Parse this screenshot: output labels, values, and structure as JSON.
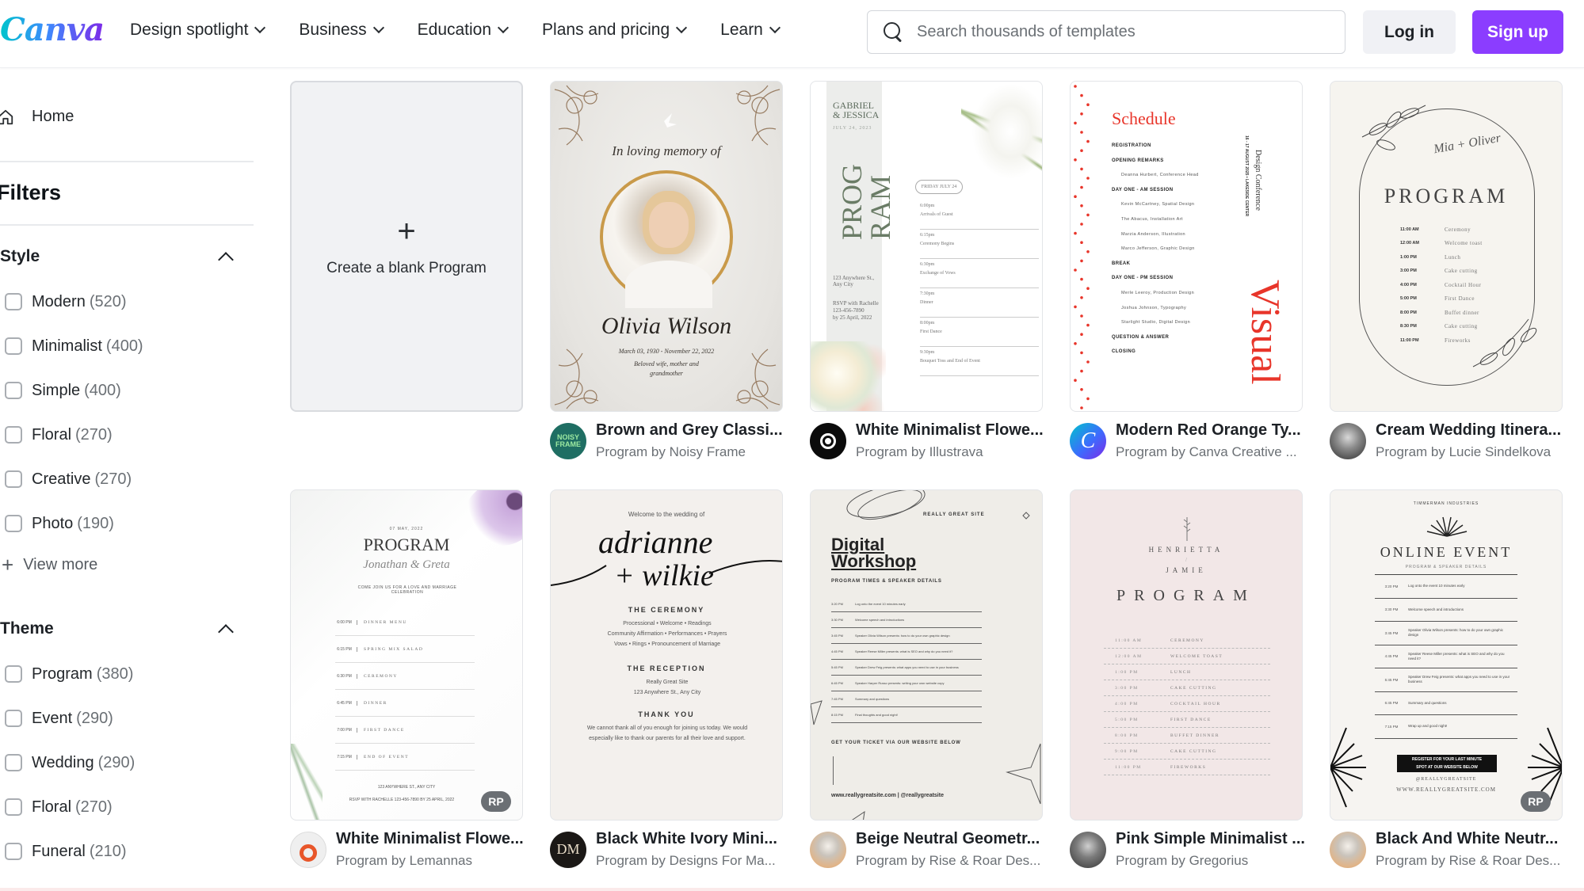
{
  "header": {
    "logo": "Canva",
    "nav": [
      {
        "label": "Design spotlight",
        "icon": "chevron-down-icon"
      },
      {
        "label": "Business",
        "icon": "chevron-down-icon"
      },
      {
        "label": "Education",
        "icon": "chevron-down-icon"
      },
      {
        "label": "Plans and pricing",
        "icon": "chevron-down-icon"
      },
      {
        "label": "Learn",
        "icon": "chevron-down-icon"
      }
    ],
    "search": {
      "placeholder": "Search thousands of templates",
      "value": "",
      "icon": "search-icon"
    },
    "login_label": "Log in",
    "signup_label": "Sign up",
    "colors": {
      "brand_purple": "#8b3dff",
      "login_bg": "#f0f1f5"
    }
  },
  "sidebar": {
    "home_label": "Home",
    "filters_title": "Filters",
    "style": {
      "title": "Style",
      "expanded": true,
      "items": [
        {
          "label": "Modern",
          "count": "(520)",
          "checked": false
        },
        {
          "label": "Minimalist",
          "count": "(400)",
          "checked": false
        },
        {
          "label": "Simple",
          "count": "(400)",
          "checked": false
        },
        {
          "label": "Floral",
          "count": "(270)",
          "checked": false
        },
        {
          "label": "Creative",
          "count": "(270)",
          "checked": false
        },
        {
          "label": "Photo",
          "count": "(190)",
          "checked": false
        }
      ],
      "view_more": "View more"
    },
    "theme": {
      "title": "Theme",
      "expanded": true,
      "items": [
        {
          "label": "Program",
          "count": "(380)",
          "checked": false
        },
        {
          "label": "Event",
          "count": "(290)",
          "checked": false
        },
        {
          "label": "Wedding",
          "count": "(290)",
          "checked": false
        },
        {
          "label": "Floral",
          "count": "(270)",
          "checked": false
        },
        {
          "label": "Funeral",
          "count": "(210)",
          "checked": false
        }
      ]
    }
  },
  "grid": {
    "blank_card": {
      "label": "Create a blank Program"
    },
    "templates": [
      {
        "title": "Brown and Grey Classi...",
        "subtitle": "Program by Noisy Frame",
        "thumb": {
          "line1": "In loving memory of",
          "name": "Olivia Wilson",
          "dates": "March 03, 1930 - November 22, 2022",
          "note1": "Beloved wife, mother and",
          "note2": "grandmother"
        }
      },
      {
        "title": "White Minimalist Flowe...",
        "subtitle": "Program by Illustrava",
        "thumb": {
          "names1": "GABRIEL",
          "names2": "& JESSICA",
          "date": "JULY 24, 2023",
          "word1": "PROG",
          "word2": "RAM",
          "pill": "FRIDAY JULY 24",
          "address": "123 Anywhere St., Any City",
          "rsvp1": "RSVP with Rachelle",
          "rsvp2": "123-456-7890",
          "rsvp3": "by 25 April, 2022",
          "rows": [
            [
              "6:00pm",
              "Arrivals of Guest"
            ],
            [
              "6:15pm",
              "Ceremony Begins"
            ],
            [
              "6:30pm",
              "Exchange of Vows"
            ],
            [
              "7:30pm",
              "Dinner"
            ],
            [
              "8:00pm",
              "First Dance"
            ],
            [
              "9:30pm",
              "Bouquet Toss and End of Event"
            ]
          ]
        }
      },
      {
        "title": "Modern Red Orange Ty...",
        "subtitle": "Program by Canva Creative ...",
        "thumb": {
          "heading": "Schedule",
          "side1": "Design Conference",
          "side2": "16 - 17 AUGUST 2025  •  LAKESIDE CENTER",
          "big": "Visual",
          "rows": [
            [
              "h",
              "REGISTRATION"
            ],
            [
              "h",
              "OPENING REMARKS"
            ],
            [
              "s",
              "Deanna Hurbert, Conference Head"
            ],
            [
              "h",
              "DAY ONE - AM SESSION"
            ],
            [
              "s",
              "Kevin McCartney, Spatial Design"
            ],
            [
              "s",
              "The Abacus, Installation Art"
            ],
            [
              "s",
              "Marzia Anderson, Illustration"
            ],
            [
              "s",
              "Marco Jefferson, Graphic Design"
            ],
            [
              "h",
              "BREAK"
            ],
            [
              "h",
              "DAY ONE - PM SESSION"
            ],
            [
              "s",
              "Merle Leeroy, Production Design"
            ],
            [
              "s",
              "Joshua Johnson, Typography"
            ],
            [
              "s",
              "Starlight Studio, Digital Design"
            ],
            [
              "h",
              "QUESTION & ANSWER"
            ],
            [
              "h",
              "CLOSING"
            ]
          ]
        }
      },
      {
        "title": "Cream Wedding Itinera...",
        "subtitle": "Program by Lucie Sindelkova",
        "thumb": {
          "script": "Mia + Oliver",
          "heading": "PROGRAM",
          "rows": [
            [
              "11:00 AM",
              "Ceremony"
            ],
            [
              "12:00 AM",
              "Welcome toast"
            ],
            [
              "1:00 PM",
              "Lunch"
            ],
            [
              "3:00 PM",
              "Cake cutting"
            ],
            [
              "4:00 PM",
              "Cocktail Hour"
            ],
            [
              "5:00 PM",
              "First Dance"
            ],
            [
              "8:00 PM",
              "Buffet dinner"
            ],
            [
              "8:30 PM",
              "Cake cutting"
            ],
            [
              "11:00 PM",
              "Fireworks"
            ]
          ]
        }
      },
      {
        "title": "White Minimalist Flowe...",
        "subtitle": "Program by Lemannas",
        "badge": "RP",
        "thumb": {
          "date": "07 MAY, 2022",
          "heading": "PROGRAM",
          "script": "Jonathan & Greta",
          "tagline": "COME JOIN US FOR A LOVE AND MARRIAGE CELEBRATION",
          "rows": [
            [
              "6:00 PM",
              "DINNER MENU"
            ],
            [
              "6:15 PM",
              "SPRING MIX SALAD"
            ],
            [
              "6:30 PM",
              "CEREMONY"
            ],
            [
              "6:45 PM",
              "DINNER"
            ],
            [
              "7:00 PM",
              "FIRST DANCE"
            ],
            [
              "7:15 PM",
              "END OF EVENT"
            ]
          ],
          "footer1": "123 ANYWHERE ST., ANY CITY",
          "footer2": "RSVP WITH RACHELLE 123-456-7890 BY 25 APRIL, 2022"
        }
      },
      {
        "title": "Black White Ivory Mini...",
        "subtitle": "Program by Designs For Ma...",
        "thumb": {
          "welcome": "Welcome to the wedding of",
          "name1": "adrianne",
          "name2": "+ wilkie",
          "h1": "THE CEREMONY",
          "p1": "Processional • Welcome • Readings\nCommunity Affirmation • Performances • Prayers\nVows • Rings • Pronouncement of Marriage",
          "h2": "THE RECEPTION",
          "p2": "Really Great Site\n123 Anywhere St., Any City",
          "h3": "THANK YOU",
          "p3": "We cannot thank all of you enough for joining us today. We would especially like to thank our parents for all their love and support."
        }
      },
      {
        "title": "Beige Neutral Geometr...",
        "subtitle": "Program by Rise & Roar Des...",
        "thumb": {
          "site": "REALLY GREAT SITE",
          "heading1": "Digital",
          "heading2": "Workshop",
          "sub": "PROGRAM TIMES & SPEAKER DETAILS",
          "rows": [
            [
              "3:20 PM",
              "Log onto the event 10 minutes early"
            ],
            [
              "3:30 PM",
              "Welcome speech and introductions"
            ],
            [
              "3:45 PM",
              "Speaker Olivia Wilson presents: how to do your own graphic design"
            ],
            [
              "4:45 PM",
              "Speaker Reese Miller presents: what is SEO and why do you need it?"
            ],
            [
              "5:45 PM",
              "Speaker Drew Feig presents: what apps you need to use in your business"
            ],
            [
              "6:45 PM",
              "Speaker Harper Russo presents: writing your own website copy"
            ],
            [
              "7:45 PM",
              "Summary and questions"
            ],
            [
              "8:15 PM",
              "Final thoughts and good night!"
            ]
          ],
          "cta": "GET YOUR TICKET VIA OUR WEBSITE BELOW",
          "footer": "www.reallygreatsite.com | @reallygreatsite"
        }
      },
      {
        "title": "Pink Simple Minimalist ...",
        "subtitle": "Program by Gregorius",
        "thumb": {
          "name1": "HENRIETTA",
          "slash": "/",
          "name2": "JAMIE",
          "heading": "PROGRAM",
          "rows": [
            [
              "11:00 AM",
              "CEREMONY"
            ],
            [
              "12:00 AM",
              "WELCOME TOAST"
            ],
            [
              "1:00 PM",
              "LUNCH"
            ],
            [
              "3:00 PM",
              "CAKE CUTTING"
            ],
            [
              "4:00 PM",
              "COCKTAIL HOUR"
            ],
            [
              "5:00 PM",
              "FIRST DANCE"
            ],
            [
              "8:00 PM",
              "BUFFET DINNER"
            ],
            [
              "9:00 PM",
              "CAKE CUTTING"
            ],
            [
              "11:00 PM",
              "FIREWORKS"
            ]
          ]
        }
      },
      {
        "title": "Black And White Neutr...",
        "subtitle": "Program by Rise & Roar Des...",
        "badge": "RP",
        "thumb": {
          "arc": "TIMMERMAN INDUSTRIES",
          "heading": "ONLINE EVENT",
          "sub": "PROGRAM & SPEAKER DETAILS",
          "rows": [
            [
              "3:20 PM",
              "Log onto the event 10 minutes early"
            ],
            [
              "3:30 PM",
              "Welcome speech and introductions"
            ],
            [
              "3:45 PM",
              "Speaker Olivia Wilson presents: how to do your own graphic design"
            ],
            [
              "4:45 PM",
              "Speaker Reese Miller presents: what is SEO and why do you need it?"
            ],
            [
              "5:45 PM",
              "Speaker Drew Feig presents: what apps you need to use in your business"
            ],
            [
              "6:45 PM",
              "Summary and questions"
            ],
            [
              "7:15 PM",
              "Wrap up and good night!"
            ]
          ],
          "cta1": "REGISTER FOR YOUR LAST MINUTE",
          "cta2": "SPOT AT OUR WEBSITE BELOW",
          "footer1": "@REALLYGREATSITE",
          "footer2": "WWW.REALLYGREATSITE.COM"
        }
      }
    ]
  }
}
